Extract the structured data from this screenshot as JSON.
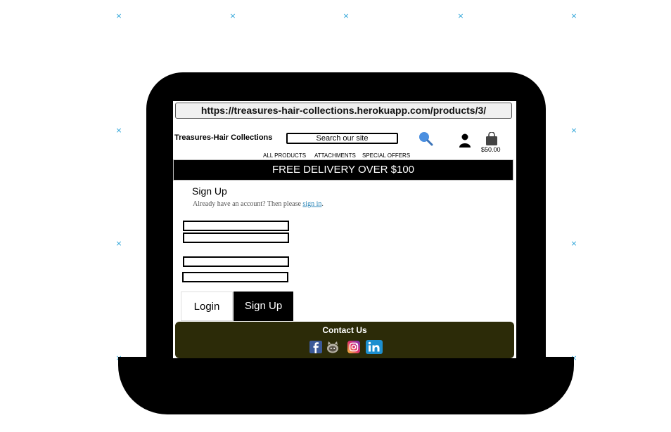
{
  "browser": {
    "url": "https://treasures-hair-collections.herokuapp.com/products/3/"
  },
  "header": {
    "brand": "Treasures-Hair Collections",
    "search_placeholder": "Search our site",
    "cart_total": "$50.00",
    "icons": [
      "search-icon",
      "user-icon",
      "shopping-bag-icon"
    ]
  },
  "nav": {
    "items": [
      "ALL PRODUCTS",
      "ATTACHMENTS",
      "SPECIAL OFFERS"
    ]
  },
  "promo": {
    "text": "FREE DELIVERY OVER $100"
  },
  "signup": {
    "title": "Sign Up",
    "prompt": "Already have an account? Then please ",
    "link": "sign in",
    "suffix": "."
  },
  "actions": {
    "login": "Login",
    "signup": "Sign Up"
  },
  "footer": {
    "title": "Contact Us",
    "icons": [
      "facebook-icon",
      "github-icon",
      "instagram-icon",
      "linkedin-icon"
    ]
  },
  "colors": {
    "background": "#ffffff",
    "laptop": "#000000",
    "promo_bar": "#000000",
    "footer": "#2c2b08",
    "link": "#2b86b8",
    "marker": "#29a3d8"
  }
}
